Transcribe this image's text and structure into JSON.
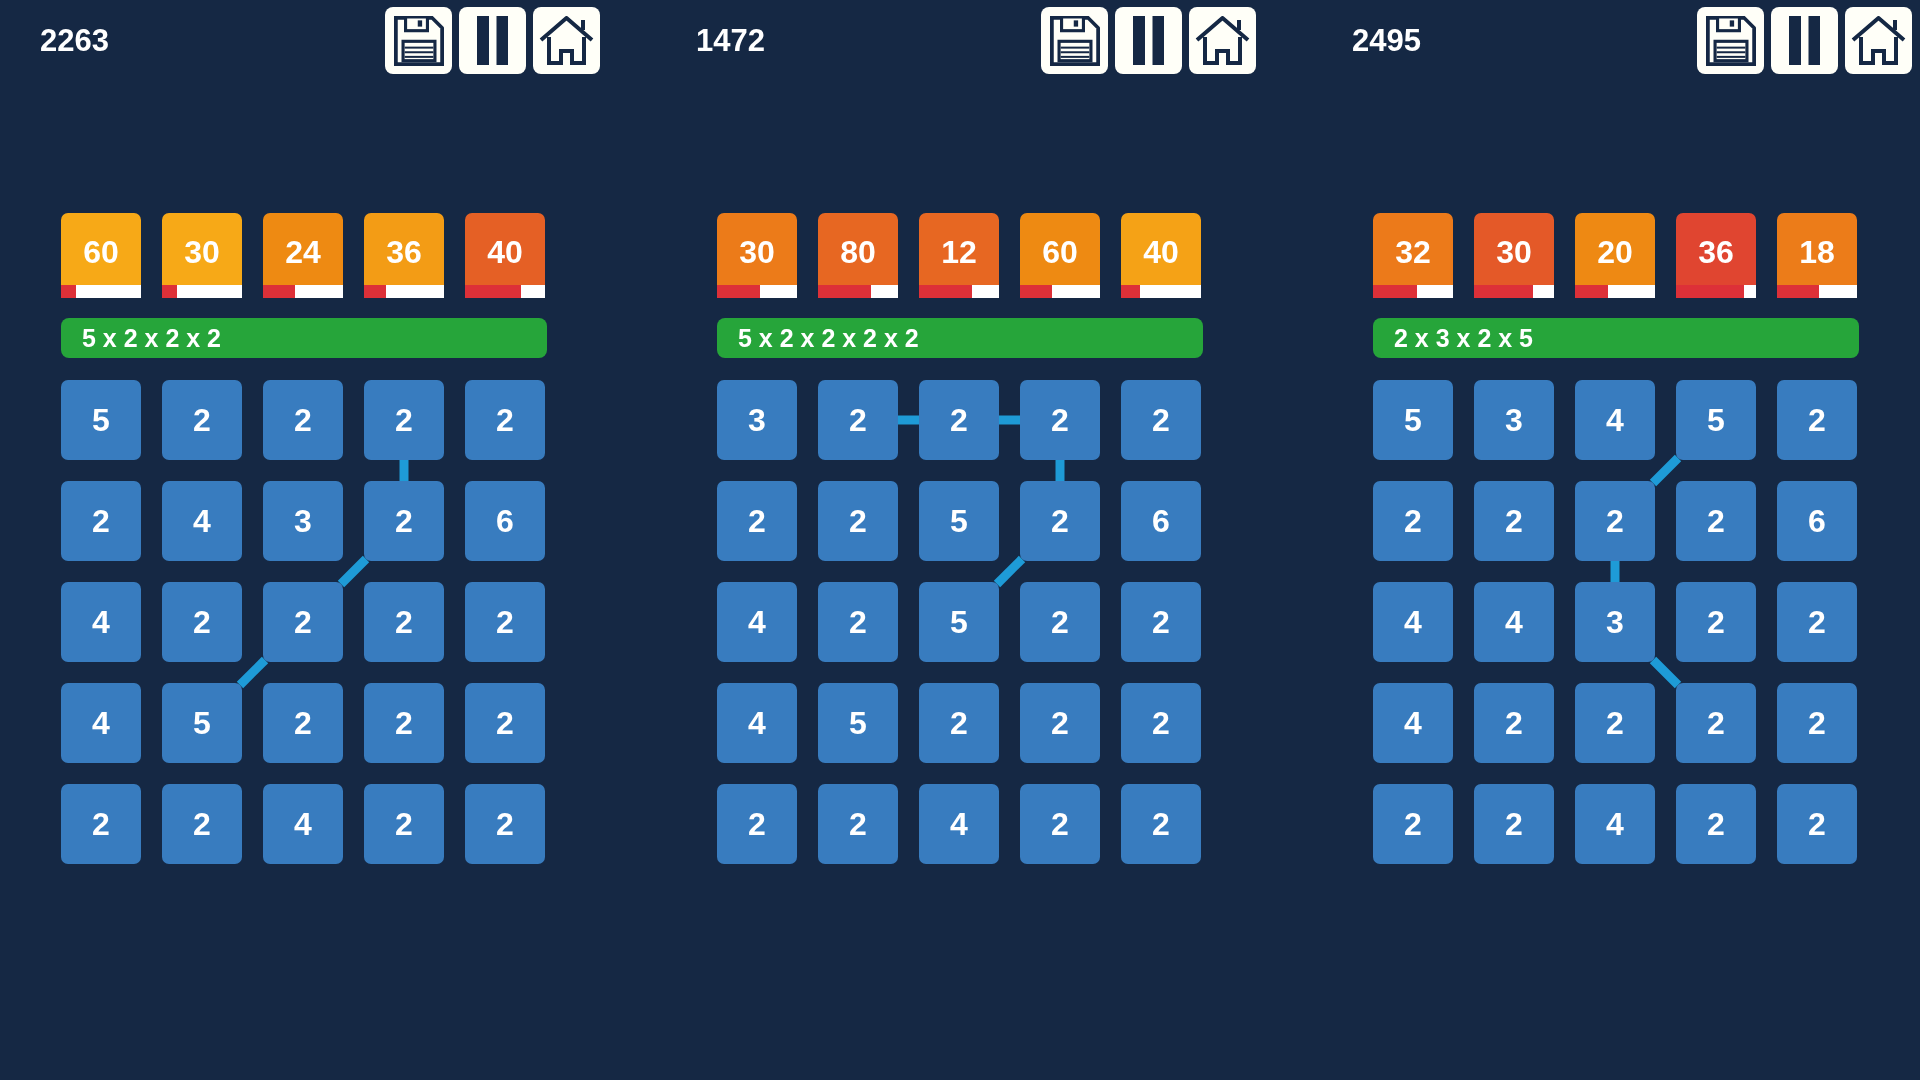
{
  "panels": [
    {
      "score": "2263",
      "targets": [
        {
          "value": "60",
          "level": 0.19
        },
        {
          "value": "30",
          "level": 0.19
        },
        {
          "value": "24",
          "level": 0.4
        },
        {
          "value": "36",
          "level": 0.28
        },
        {
          "value": "40",
          "level": 0.7
        }
      ],
      "formula": "5 x 2 x 2 x 2",
      "grid": [
        [
          {
            "value": "5",
            "kind": "plain"
          },
          {
            "value": "2",
            "kind": "plain"
          },
          {
            "value": "2",
            "kind": "plain"
          },
          {
            "value": "2",
            "kind": "down"
          },
          {
            "value": "2",
            "kind": "plain"
          }
        ],
        [
          {
            "value": "2",
            "kind": "plain"
          },
          {
            "value": "4",
            "kind": "plain"
          },
          {
            "value": "3",
            "kind": "plain"
          },
          {
            "value": "2",
            "kind": "downleft"
          },
          {
            "value": "6",
            "kind": "plain"
          }
        ],
        [
          {
            "value": "4",
            "kind": "plain"
          },
          {
            "value": "2",
            "kind": "plain"
          },
          {
            "value": "2",
            "kind": "downleft"
          },
          {
            "value": "2",
            "kind": "plain"
          },
          {
            "value": "2",
            "kind": "plain"
          }
        ],
        [
          {
            "value": "4",
            "kind": "plain"
          },
          {
            "value": "5",
            "kind": "plain"
          },
          {
            "value": "2",
            "kind": "plain"
          },
          {
            "value": "2",
            "kind": "plain"
          },
          {
            "value": "2",
            "kind": "plain"
          }
        ],
        [
          {
            "value": "2",
            "kind": "plain"
          },
          {
            "value": "2",
            "kind": "plain"
          },
          {
            "value": "4",
            "kind": "plain"
          },
          {
            "value": "2",
            "kind": "plain"
          },
          {
            "value": "2",
            "kind": "plain"
          }
        ]
      ]
    },
    {
      "score": "1472",
      "targets": [
        {
          "value": "30",
          "level": 0.54
        },
        {
          "value": "80",
          "level": 0.66
        },
        {
          "value": "12",
          "level": 0.66
        },
        {
          "value": "60",
          "level": 0.4
        },
        {
          "value": "40",
          "level": 0.24
        }
      ],
      "formula": "5 x 2 x 2 x 2 x 2",
      "grid": [
        [
          {
            "value": "3",
            "kind": "plain"
          },
          {
            "value": "2",
            "kind": "right"
          },
          {
            "value": "2",
            "kind": "right"
          },
          {
            "value": "2",
            "kind": "down"
          },
          {
            "value": "2",
            "kind": "plain"
          }
        ],
        [
          {
            "value": "2",
            "kind": "plain"
          },
          {
            "value": "2",
            "kind": "plain"
          },
          {
            "value": "5",
            "kind": "plain"
          },
          {
            "value": "2",
            "kind": "downleft"
          },
          {
            "value": "6",
            "kind": "plain"
          }
        ],
        [
          {
            "value": "4",
            "kind": "plain"
          },
          {
            "value": "2",
            "kind": "plain"
          },
          {
            "value": "5",
            "kind": "plain"
          },
          {
            "value": "2",
            "kind": "plain"
          },
          {
            "value": "2",
            "kind": "plain"
          }
        ],
        [
          {
            "value": "4",
            "kind": "plain"
          },
          {
            "value": "5",
            "kind": "plain"
          },
          {
            "value": "2",
            "kind": "plain"
          },
          {
            "value": "2",
            "kind": "plain"
          },
          {
            "value": "2",
            "kind": "plain"
          }
        ],
        [
          {
            "value": "2",
            "kind": "plain"
          },
          {
            "value": "2",
            "kind": "plain"
          },
          {
            "value": "4",
            "kind": "plain"
          },
          {
            "value": "2",
            "kind": "plain"
          },
          {
            "value": "2",
            "kind": "plain"
          }
        ]
      ]
    },
    {
      "score": "2495",
      "targets": [
        {
          "value": "32",
          "level": 0.55
        },
        {
          "value": "30",
          "level": 0.74
        },
        {
          "value": "20",
          "level": 0.41
        },
        {
          "value": "36",
          "level": 0.85
        },
        {
          "value": "18",
          "level": 0.53
        }
      ],
      "formula": "2 x 3 x 2 x 5",
      "grid": [
        [
          {
            "value": "5",
            "kind": "plain"
          },
          {
            "value": "3",
            "kind": "plain"
          },
          {
            "value": "4",
            "kind": "plain"
          },
          {
            "value": "5",
            "kind": "downleft"
          },
          {
            "value": "2",
            "kind": "plain"
          }
        ],
        [
          {
            "value": "2",
            "kind": "plain"
          },
          {
            "value": "2",
            "kind": "plain"
          },
          {
            "value": "2",
            "kind": "down"
          },
          {
            "value": "2",
            "kind": "plain"
          },
          {
            "value": "6",
            "kind": "plain"
          }
        ],
        [
          {
            "value": "4",
            "kind": "plain"
          },
          {
            "value": "4",
            "kind": "plain"
          },
          {
            "value": "3",
            "kind": "downright"
          },
          {
            "value": "2",
            "kind": "plain"
          },
          {
            "value": "2",
            "kind": "plain"
          }
        ],
        [
          {
            "value": "4",
            "kind": "plain"
          },
          {
            "value": "2",
            "kind": "plain"
          },
          {
            "value": "2",
            "kind": "plain"
          },
          {
            "value": "2",
            "kind": "plain"
          },
          {
            "value": "2",
            "kind": "plain"
          }
        ],
        [
          {
            "value": "2",
            "kind": "plain"
          },
          {
            "value": "2",
            "kind": "plain"
          },
          {
            "value": "4",
            "kind": "plain"
          },
          {
            "value": "2",
            "kind": "plain"
          },
          {
            "value": "2",
            "kind": "plain"
          }
        ]
      ]
    }
  ]
}
